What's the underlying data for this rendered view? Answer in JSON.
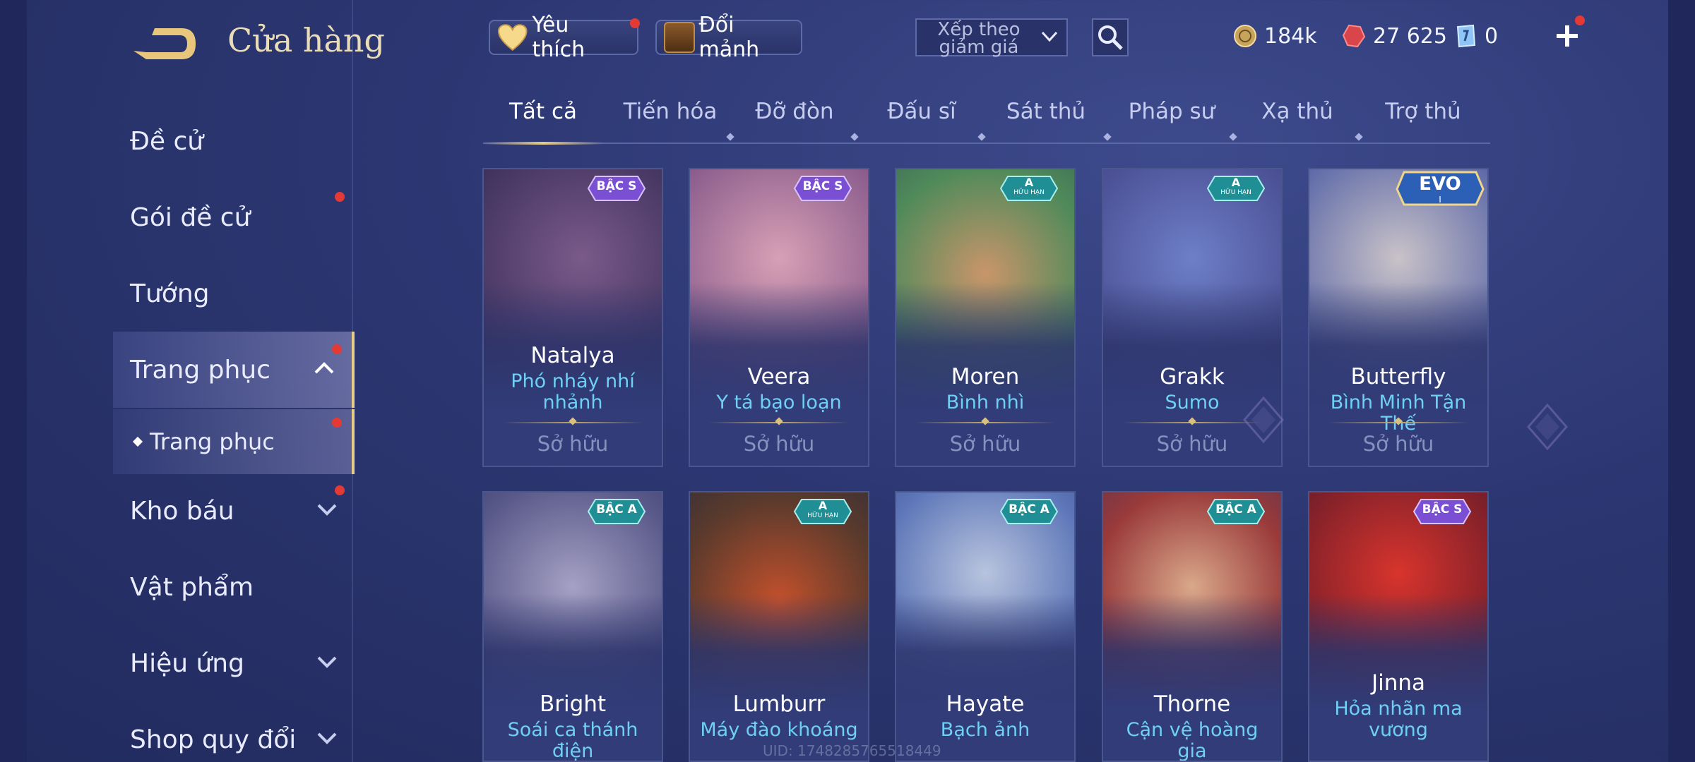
{
  "header": {
    "title": "Cửa hàng"
  },
  "toolbar": {
    "favorites_label": "Yêu thích",
    "exchange_label": "Đổi mảnh",
    "sort": {
      "value": "Xếp theo giảm giá"
    }
  },
  "currencies": [
    {
      "icon": "gold-coin-icon",
      "value": "184k"
    },
    {
      "icon": "ruby-gem-icon",
      "value": "27 625"
    },
    {
      "icon": "voucher-icon",
      "value": "0"
    }
  ],
  "sidebar": {
    "items": [
      {
        "label": "Đề cử"
      },
      {
        "label": "Gói đề cử"
      },
      {
        "label": "Tướng"
      },
      {
        "label": "Trang phục"
      },
      {
        "label": "Trang phục"
      },
      {
        "label": "Kho báu"
      },
      {
        "label": "Vật phẩm"
      },
      {
        "label": "Hiệu ứng"
      },
      {
        "label": "Shop quy đổi"
      }
    ]
  },
  "tabs": [
    "Tất cả",
    "Tiến hóa",
    "Đỡ đòn",
    "Đấu sĩ",
    "Sát thủ",
    "Pháp sư",
    "Xạ thủ",
    "Trợ thủ"
  ],
  "cards": [
    {
      "hero": "Natalya",
      "skin_line1": "Phó nháy nhí",
      "skin_line2": "nhảnh",
      "status": "Sở hữu",
      "badge": "BẬC S"
    },
    {
      "hero": "Veera",
      "skin_line1": "Y tá bạo loạn",
      "skin_line2": "",
      "status": "Sở hữu",
      "badge": "BẬC S"
    },
    {
      "hero": "Moren",
      "skin_line1": "Bình nhì",
      "skin_line2": "",
      "status": "Sở hữu",
      "badge": "A",
      "badge_sub": "HỮU HẠN"
    },
    {
      "hero": "Grakk",
      "skin_line1": "Sumo",
      "skin_line2": "",
      "status": "Sở hữu",
      "badge": "A",
      "badge_sub": "HỮU HẠN"
    },
    {
      "hero": "Butterfly",
      "skin_line1": "Bình Minh Tận Thế",
      "skin_line2": "",
      "status": "Sở hữu",
      "badge": "EVO",
      "badge_sub": "I"
    },
    {
      "hero": "Bright",
      "skin_line1": "Soái ca thánh điện",
      "skin_line2": "",
      "badge": "BẬC A"
    },
    {
      "hero": "Lumburr",
      "skin_line1": "Máy đào khoáng",
      "skin_line2": "",
      "badge": "A",
      "badge_sub": "HỮU HẠN"
    },
    {
      "hero": "Hayate",
      "skin_line1": "Bạch ảnh",
      "skin_line2": "",
      "badge": "BẬC A"
    },
    {
      "hero": "Thorne",
      "skin_line1": "Cận vệ hoàng gia",
      "skin_line2": "",
      "badge": "BẬC A"
    },
    {
      "hero": "Jinna",
      "skin_line1": "Hỏa nhãn ma",
      "skin_line2": "vương",
      "badge": "BẬC S"
    }
  ],
  "watermark": "UID: 1748285765518449",
  "colors": {
    "accent_gold": "#e7cc86",
    "skin_name": "#6fd0f5",
    "notify": "#e43a35",
    "badge_s": "#7b4fd3",
    "badge_a": "#1f8f95"
  }
}
